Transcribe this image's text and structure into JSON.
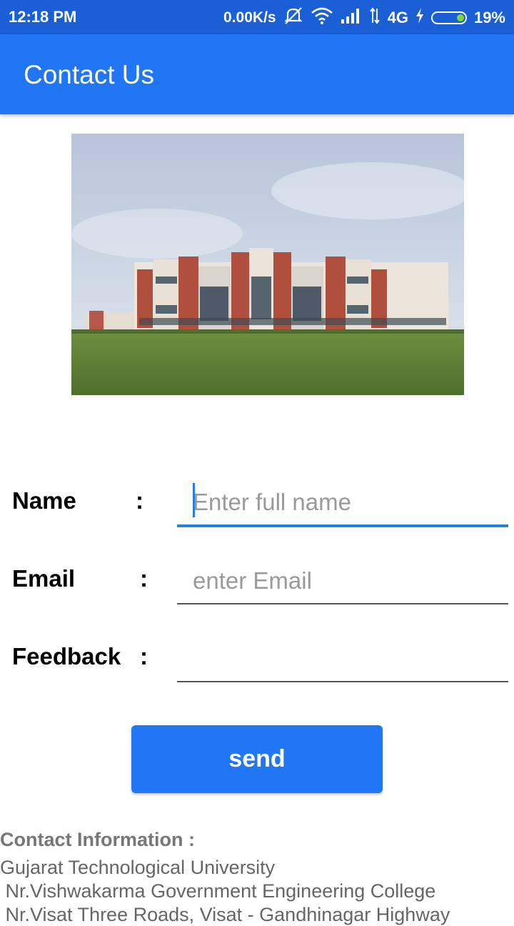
{
  "status_bar": {
    "time": "12:18 PM",
    "net_speed": "0.00K/s",
    "network_type": "4G",
    "battery_percent": "19%",
    "battery_level": 0.19,
    "icons": [
      "mute-icon",
      "wifi-icon",
      "signal-icon",
      "data-arrows-icon",
      "charging-icon",
      "battery-icon"
    ]
  },
  "app_bar": {
    "title": "Contact Us"
  },
  "form": {
    "name_label": "Name",
    "name_placeholder": "Enter full name",
    "email_label": "Email",
    "email_placeholder": "enter Email",
    "feedback_label": "Feedback",
    "feedback_placeholder": "",
    "colon": ":"
  },
  "send_button": {
    "label": "send"
  },
  "contact_info": {
    "heading": "Contact Information :",
    "lines": [
      "Gujarat Technological University",
      " Nr.Vishwakarma Government Engineering College",
      " Nr.Visat Three Roads, Visat - Gandhinagar Highway"
    ]
  },
  "colors": {
    "status_bar": "#1a5fd6",
    "app_bar": "#2176f5",
    "accent": "#2a7de1",
    "button": "#2176f5"
  }
}
